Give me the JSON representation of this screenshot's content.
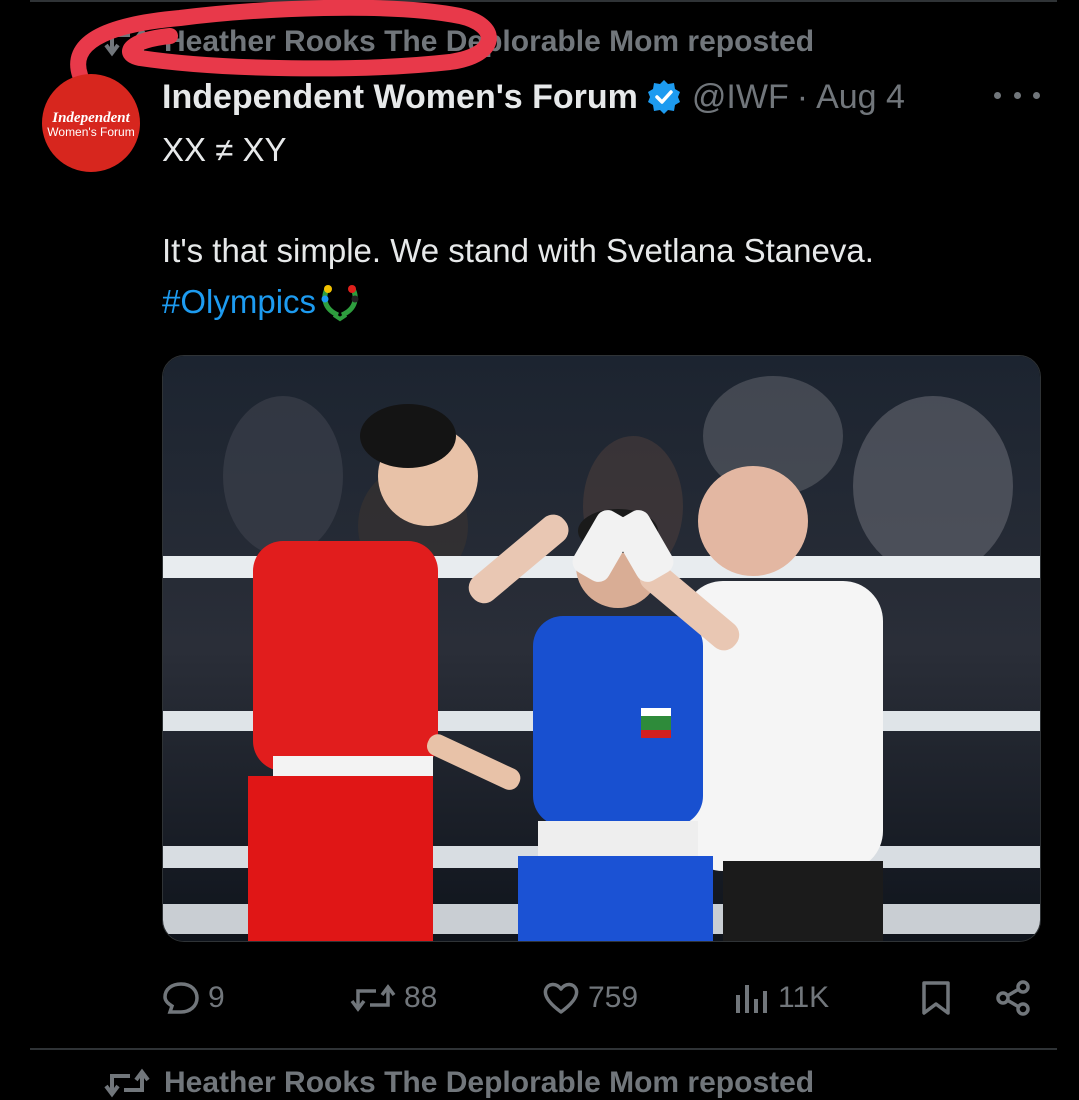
{
  "repost": {
    "text": "Heather Rooks The Deplorable Mom reposted"
  },
  "post": {
    "author_name": "Independent Women's Forum",
    "verified": true,
    "handle": "@IWF",
    "separator": "·",
    "date": "Aug 4",
    "avatar": {
      "line1": "Independent",
      "line2": "Women's Forum",
      "color": "#d7261e"
    },
    "text_line1": "XX ≠ XY",
    "text_line2": "It's that simple. We stand with Svetlana Staneva.",
    "hashtag": "#Olympics",
    "image_icon": "boxing-ring-photo"
  },
  "actions": {
    "replies": "9",
    "reposts": "88",
    "likes": "759",
    "views": "11K"
  },
  "next_repost": {
    "text": "Heather Rooks The Deplorable Mom reposted"
  },
  "colors": {
    "background": "#000000",
    "text": "#e7e9ea",
    "muted": "#71767b",
    "accent": "#1d9bf0",
    "scribble": "#e8394a"
  }
}
